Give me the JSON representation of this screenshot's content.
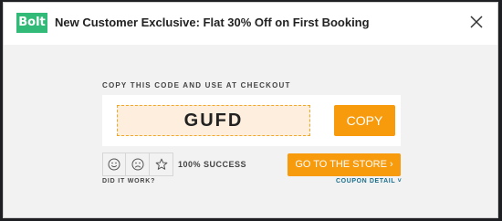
{
  "header": {
    "logo_text": "Bolt",
    "title": "New Customer Exclusive: Flat 30% Off on First Booking"
  },
  "coupon": {
    "instruction": "COPY THIS CODE AND USE AT CHECKOUT",
    "code": "GUFD",
    "copy_label": "COPY"
  },
  "feedback": {
    "success_text": "100% SUCCESS",
    "question": "DID IT WORK?",
    "icons": [
      "smile-icon",
      "frown-icon",
      "star-icon"
    ]
  },
  "actions": {
    "store_label": "GO TO THE STORE ›",
    "detail_label": "COUPON DETAIL ˅"
  },
  "colors": {
    "accent": "#f79a0c",
    "brand": "#32bb78",
    "link": "#1a6e8c",
    "code_bg": "#fdeedd"
  }
}
